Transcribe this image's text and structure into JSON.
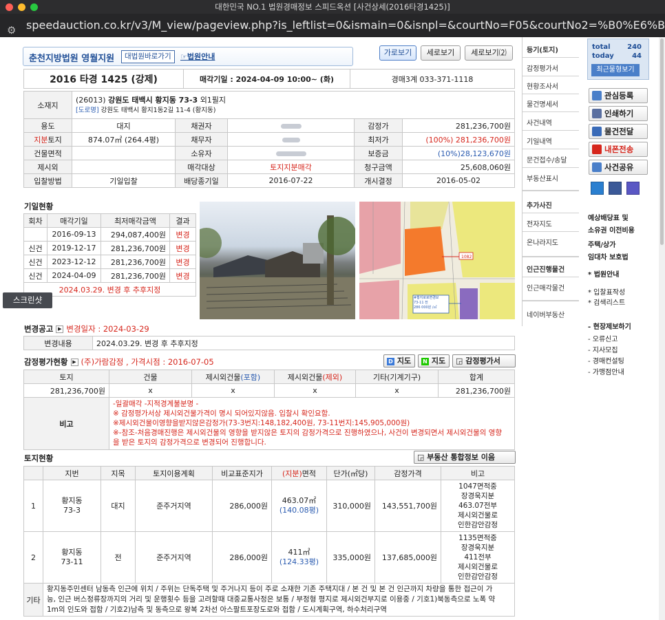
{
  "window": {
    "title": "대한민국 NO.1 법원경매정보 스피드옥션 [사건상세(2016타경1425)]",
    "url": "speedauction.co.kr/v3/M_view/pageview.php?is_leftlist=0&ismain=0&isnpl=&courtNo=F05&courtNo2=%B0%E6%B8%C53%B0%E8&eventN..."
  },
  "header": {
    "court": "춘천지방법원 영월지원",
    "court_btn": "대법원바로가기",
    "court_btn2": "법원안내",
    "views": [
      "가로보기",
      "세로보기",
      "세로보기⑵"
    ]
  },
  "case": {
    "number": "2016 타경 1425 (강제)",
    "sale_date": "매각기일 : 2024-04-09 10:00~ (화)",
    "dept": "경매3계 033-371-1118"
  },
  "address": {
    "label": "소재지",
    "line1_pre": "(26013)",
    "line1_bold": "강원도 태백시 황지동 73-3",
    "line1_post": "외1필지",
    "road_tag": "[도로명]",
    "road": "강원도 태백시 황지1동2길 11-4 (황지동)"
  },
  "info": {
    "r1": [
      "용도",
      "대지",
      "채권자",
      "감정가",
      "281,236,700원"
    ],
    "r2": [
      "지분",
      "토지",
      "874.07㎡ (264.4평)",
      "채무자",
      "최저가",
      "(100%) 281,236,700원"
    ],
    "r3": [
      "건물면적",
      "",
      "소유자",
      "보증금",
      "(10%)28,123,670원"
    ],
    "r4": [
      "제시외",
      "",
      "매각대상",
      "토지지분매각",
      "청구금액",
      "25,608,060원"
    ],
    "r5": [
      "입찰방법",
      "기일입찰",
      "배당종기일",
      "2016-07-22",
      "개시결정",
      "2016-05-02"
    ]
  },
  "history": {
    "title": "기일현황",
    "headers": [
      "회차",
      "매각기일",
      "최저매각금액",
      "결과"
    ],
    "rows": [
      [
        "",
        "2016-09-13",
        "294,087,400원",
        "변경"
      ],
      [
        "신건",
        "2019-12-17",
        "281,236,700원",
        "변경"
      ],
      [
        "신건",
        "2023-12-12",
        "281,236,700원",
        "변경"
      ],
      [
        "신건",
        "2024-04-09",
        "281,236,700원",
        "변경"
      ]
    ],
    "note": "2024.03.29. 변경 후 추후지정"
  },
  "screenshot_label": "스크린샷",
  "map": {
    "road_label": "1082",
    "box_text": "#황지로로변경보\n73-11 전\n286 000원 /㎡"
  },
  "change": {
    "title": "변경공고",
    "date": "변경일자 : 2024-03-29",
    "label": "변경내용",
    "content": "2024.03.29. 변경 후 추후지정"
  },
  "appraisal": {
    "title": "감정평가현황",
    "sub": "(주)가람감정 , 가격시점 : 2016-07-05",
    "btn_d": "지도",
    "btn_n": "지도",
    "btn_doc": "감정평가서",
    "headers": [
      "토지",
      "건물",
      "제시외건물",
      "(포함)",
      "제시외건물",
      "(제외)",
      "기타(기계기구)",
      "합계"
    ],
    "values": [
      "281,236,700원",
      "x",
      "x",
      "x",
      "x",
      "281,236,700원"
    ],
    "remark_label": "비고",
    "remarks": [
      "-일괄매각 -지적경계불분명 -",
      "※ 감정평가서상 제시외건물가격이 명시 되어있지않음. 입찰시 확인요함.",
      "※제시외건물이영향을받지않은감정가(73-3번지:148,182,400원, 73-11번지:145,905,000원)",
      "※-참조-처음경매진행은 제시외건물의 영향을 받지않은 토지의 감정가격으로 진행하였으나, 사건이 변경되면서 제시외건물의 영향",
      "을 받은 토지의 감정가격으로 변경되어 진행합니다."
    ]
  },
  "land": {
    "title": "토지현황",
    "btn": "부동산 통합정보 이음",
    "headers": [
      "지번",
      "지목",
      "토지이용계획",
      "비교표준지가",
      "(지분)",
      "면적",
      "단가(㎡당)",
      "감정가격",
      "비고"
    ],
    "rows": [
      {
        "no": "1",
        "lot1": "황지동",
        "lot2": "73-3",
        "type": "대지",
        "plan": "준주거지역",
        "std": "286,000원",
        "area": "463.07㎡",
        "pyeong": "(140.08평)",
        "unit": "310,000원",
        "price": "143,551,700원",
        "note": [
          "1047면적중",
          "장경욱지분",
          "463.07전부",
          "제시외건물로",
          "인한감안감정"
        ]
      },
      {
        "no": "2",
        "lot1": "황지동",
        "lot2": "73-11",
        "type": "전",
        "plan": "준주거지역",
        "std": "286,000원",
        "area": "411㎡",
        "pyeong": "(124.33평)",
        "unit": "335,000원",
        "price": "137,685,000원",
        "note": [
          "1135면적중",
          "장경욱지분",
          "411전부",
          "제시외건물로",
          "인한감안감정"
        ]
      }
    ],
    "etc_label": "기타",
    "etc": [
      "황지동주민센터 남동측 인근에 위치 / 주위는 단독주택 및 주거나지 등이 주로 소재한 기존 주택지대 / 본 건 및 본 건 인근까지 차량을 통한 접근이 가",
      "능, 인근 버스정류장까지의 거리 및 운행횟수 등을 고려할때 대중교통사정은 보통 / 부정형 평지로 제시외건부지로 이용중 / 기호1)북동측으로 노폭 약",
      "1m의 인도와 접함 / 기호2)남측 및 동측으로 왕복 2차선 아스팔트포장도로와 접함 / 도시계획구역, 하수처리구역"
    ]
  },
  "sidebar": {
    "items": [
      "등기(토지)",
      "감정평가서",
      "현황조사서",
      "물건명세서",
      "사건내역",
      "기일내역",
      "문건접수/송달",
      "부동산표시",
      "추가사진",
      "전자지도",
      "온나라지도",
      "인근진행물건",
      "인근매각물건",
      "네이버부동산"
    ]
  },
  "right": {
    "total_label": "total",
    "total": "240",
    "today_label": "today",
    "today": "44",
    "recent": "최근물형보기",
    "btns": [
      "관심등록",
      "인쇄하기",
      "물건전달",
      "내폰전송",
      "사건공유"
    ],
    "texts": [
      "예상배당표 및",
      "소유권 이전비용",
      "주택/상가",
      "임대차 보호법",
      "* 법원안내",
      "* 입찰표작성",
      "* 검색리스트",
      "- 현장제보하기",
      "- 오류신고",
      "- 지사모집",
      "- 경매컨설팅",
      "- 가맹점안내"
    ]
  }
}
